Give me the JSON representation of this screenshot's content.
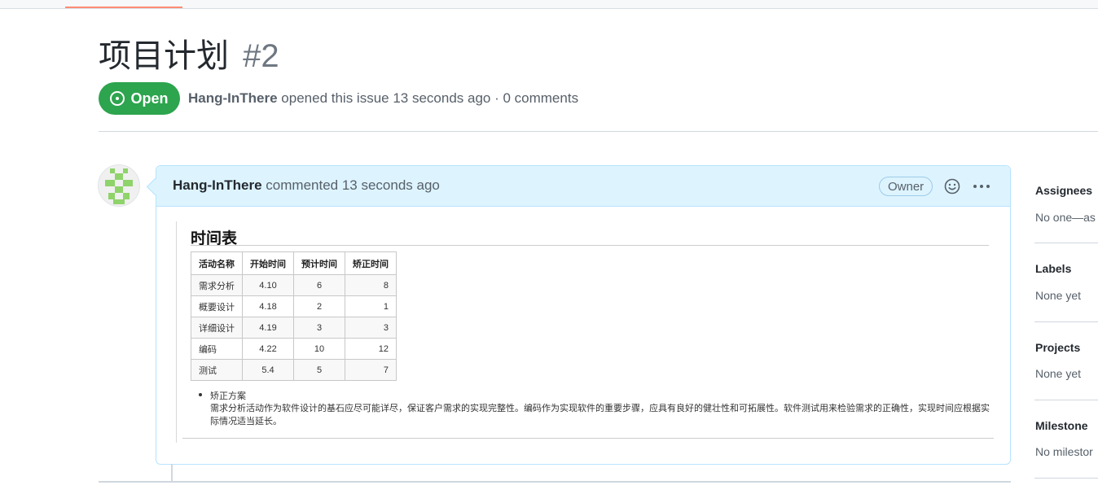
{
  "issue": {
    "title": "项目计划",
    "number": "#2",
    "state": "Open",
    "author": "Hang-InThere",
    "meta_text": "opened this issue 13 seconds ago · 0 comments"
  },
  "comment": {
    "author": "Hang-InThere",
    "action_text": "commented 13 seconds ago",
    "role_badge": "Owner",
    "icons": [
      "smiley-icon",
      "kebab-horizontal-icon"
    ],
    "body": {
      "heading": "时间表",
      "table": {
        "headers": [
          "活动名称",
          "开始时间",
          "预计时间",
          "矫正时间"
        ],
        "rows": [
          [
            "需求分析",
            "4.10",
            "6",
            "8"
          ],
          [
            "概要设计",
            "4.18",
            "2",
            "1"
          ],
          [
            "详细设计",
            "4.19",
            "3",
            "3"
          ],
          [
            "编码",
            "4.22",
            "10",
            "12"
          ],
          [
            "测试",
            "5.4",
            "5",
            "7"
          ]
        ]
      },
      "bullet_label": "矫正方案",
      "bullet_text": "需求分析活动作为软件设计的基石应尽可能详尽，保证客户需求的实现完整性。编码作为实现软件的重要步骤，应具有良好的健壮性和可拓展性。软件测试用来检验需求的正确性，实现时间应根据实际情况适当延长。"
    }
  },
  "sidebar": {
    "assignees_label": "Assignees",
    "assignees_value": "No one—as",
    "labels_label": "Labels",
    "labels_value": "None yet",
    "projects_label": "Projects",
    "projects_value": "None yet",
    "milestone_label": "Milestone",
    "milestone_value": "No milestor"
  },
  "colors": {
    "open_green": "#2da44e",
    "comment_header_bg": "#ddf4ff",
    "comment_border": "#b6e3ff",
    "tab_accent": "#fd8c73"
  }
}
